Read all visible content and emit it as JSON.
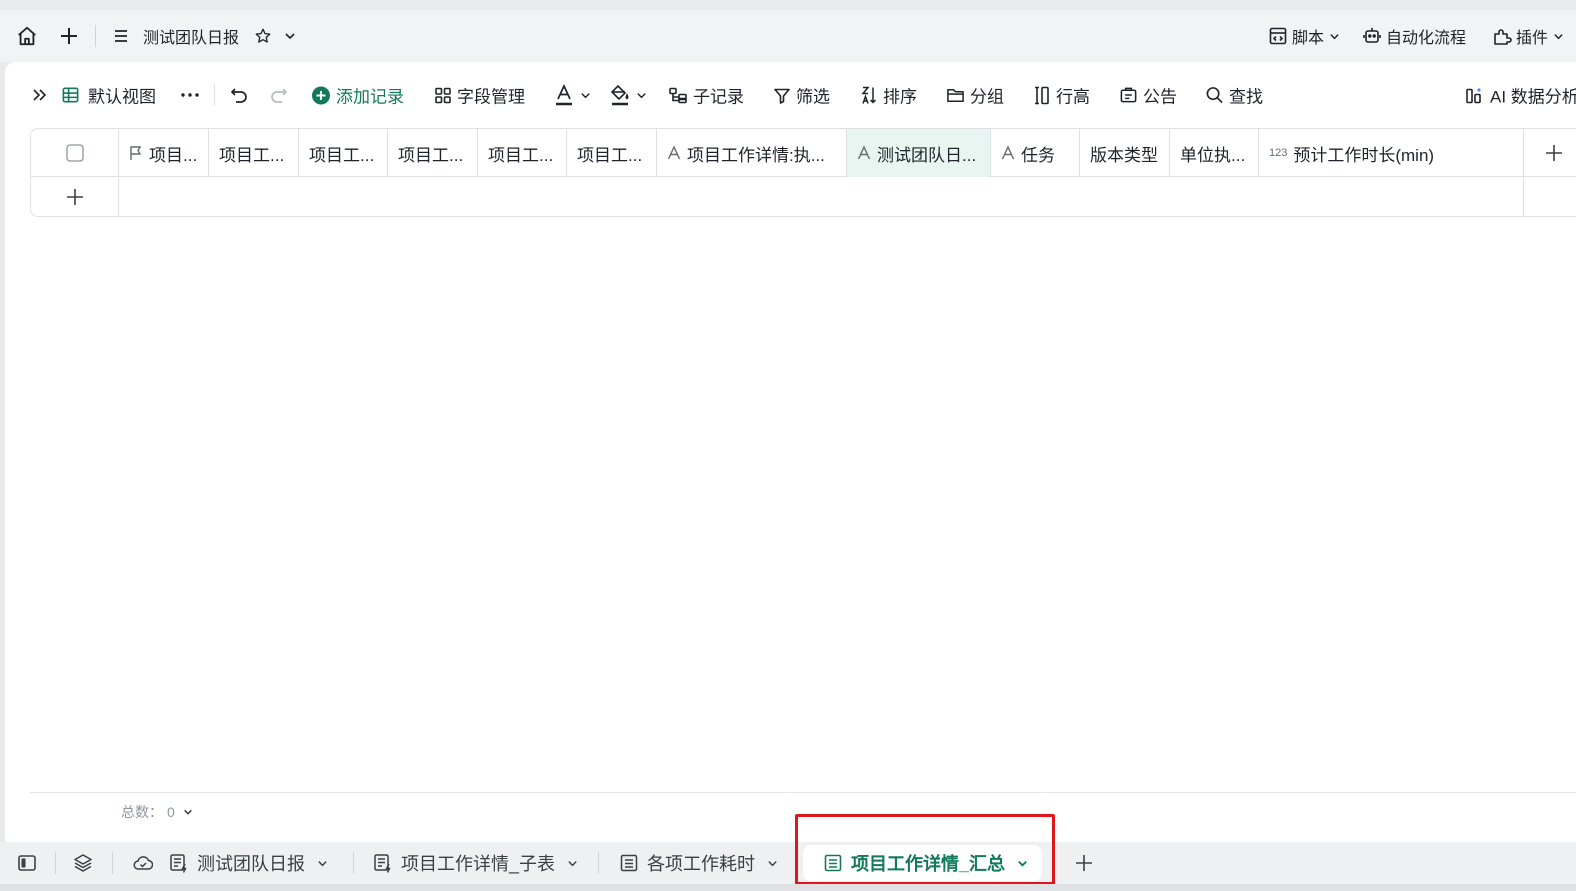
{
  "topbar": {
    "doc_title": "测试团队日报",
    "right_items": [
      {
        "label": "脚本",
        "icon": "script-icon",
        "has_dropdown": true
      },
      {
        "label": "自动化流程",
        "icon": "robot-icon",
        "has_dropdown": false
      },
      {
        "label": "插件",
        "icon": "puzzle-icon",
        "has_dropdown": true
      }
    ]
  },
  "toolbar": {
    "view_name": "默认视图",
    "add_record": "添加记录",
    "field_manage": "字段管理",
    "sub_records": "子记录",
    "filter": "筛选",
    "sort": "排序",
    "group": "分组",
    "row_height": "行高",
    "notice": "公告",
    "search": "查找",
    "ai_analysis": "AI 数据分析"
  },
  "table": {
    "columns": [
      {
        "label": "项目...",
        "type_icon": "flag-icon"
      },
      {
        "label": "项目工...",
        "type_icon": ""
      },
      {
        "label": "项目工...",
        "type_icon": ""
      },
      {
        "label": "项目工...",
        "type_icon": ""
      },
      {
        "label": "项目工...",
        "type_icon": ""
      },
      {
        "label": "项目工...",
        "type_icon": ""
      },
      {
        "label": "项目工作详情:执...",
        "type_icon": "text-icon"
      },
      {
        "label": "测试团队日...",
        "type_icon": "text-icon",
        "selected": true
      },
      {
        "label": "任务",
        "type_icon": "text-icon"
      },
      {
        "label": "版本类型",
        "type_icon": ""
      },
      {
        "label": "单位执...",
        "type_icon": ""
      },
      {
        "label": "预计工作时长(min)",
        "type_icon": "number-icon",
        "type_icon_text": "123"
      }
    ],
    "rows": []
  },
  "footer": {
    "count_label": "总数：",
    "count_value": "0"
  },
  "sheets": [
    {
      "label": "测试团队日报",
      "icon": "sheet-automation-icon",
      "active": false
    },
    {
      "label": "项目工作详情_子表",
      "icon": "sheet-automation-icon",
      "active": false
    },
    {
      "label": "各项工作耗时",
      "icon": "sheet-icon",
      "active": false
    },
    {
      "label": "项目工作详情_汇总",
      "icon": "sheet-icon",
      "active": true
    }
  ],
  "colors": {
    "accent": "#127a5a",
    "highlight_box": "#e0161e",
    "selected_header": "#e8f5f1"
  }
}
